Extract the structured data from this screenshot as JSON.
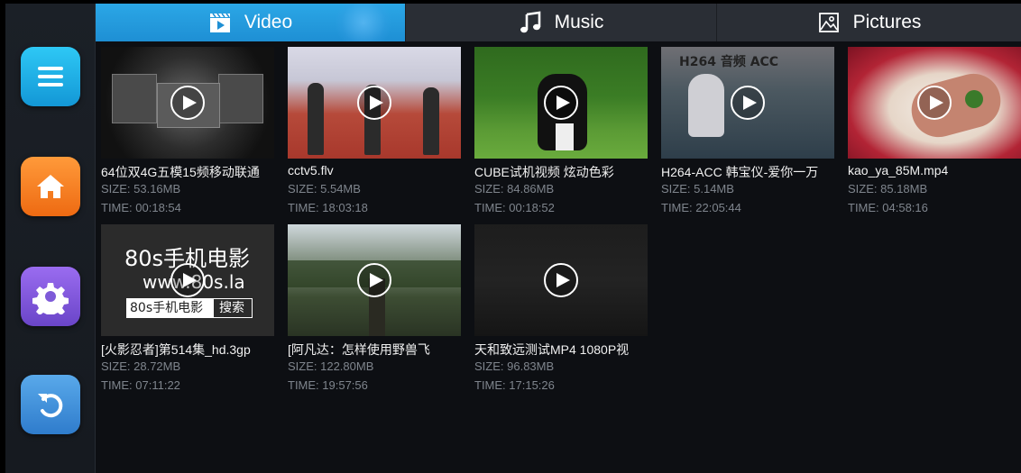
{
  "tabs": [
    {
      "label": "Video",
      "icon": "video-clapper-icon",
      "active": true
    },
    {
      "label": "Music",
      "icon": "music-note-icon",
      "active": false
    },
    {
      "label": "Pictures",
      "icon": "picture-icon",
      "active": false
    }
  ],
  "sidebar": [
    {
      "name": "menu",
      "icon": "menu-icon",
      "color": "#1fb6e8"
    },
    {
      "name": "home",
      "icon": "home-icon",
      "color": "#f47b20"
    },
    {
      "name": "settings",
      "icon": "gear-icon",
      "color": "#7e5ad8"
    },
    {
      "name": "back",
      "icon": "back-arrow-icon",
      "color": "#3d8fd6"
    }
  ],
  "videos": [
    {
      "title": "64位双4G五模15频移动联通",
      "size": "SIZE: 53.16MB",
      "time": "TIME: 00:18:54"
    },
    {
      "title": "cctv5.flv",
      "size": "SIZE: 5.54MB",
      "time": "TIME: 18:03:18"
    },
    {
      "title": "CUBE试机视频 炫动色彩",
      "size": "SIZE: 84.86MB",
      "time": "TIME: 00:18:52"
    },
    {
      "title": "H264-ACC 韩宝仪-爱你一万",
      "size": "SIZE: 5.14MB",
      "time": "TIME: 22:05:44"
    },
    {
      "title": "kao_ya_85M.mp4",
      "size": "SIZE: 85.18MB",
      "time": "TIME: 04:58:16"
    },
    {
      "title": "[火影忍者]第514集_hd.3gp",
      "size": "SIZE: 28.72MB",
      "time": "TIME: 07:11:22"
    },
    {
      "title": "[阿凡达：怎样使用野兽飞",
      "size": "SIZE: 122.80MB",
      "time": "TIME: 19:57:56"
    },
    {
      "title": "天和致远测试MP4 1080P视",
      "size": "SIZE: 96.83MB",
      "time": "TIME: 17:15:26"
    }
  ],
  "thumb_text": {
    "h264_overlay": "H264 音频 ACC",
    "site_big": "80s手机电影",
    "site_url": "www.80s.la",
    "site_box": "80s手机电影",
    "site_search": "搜索"
  },
  "accent_color": "#2ba7e6"
}
